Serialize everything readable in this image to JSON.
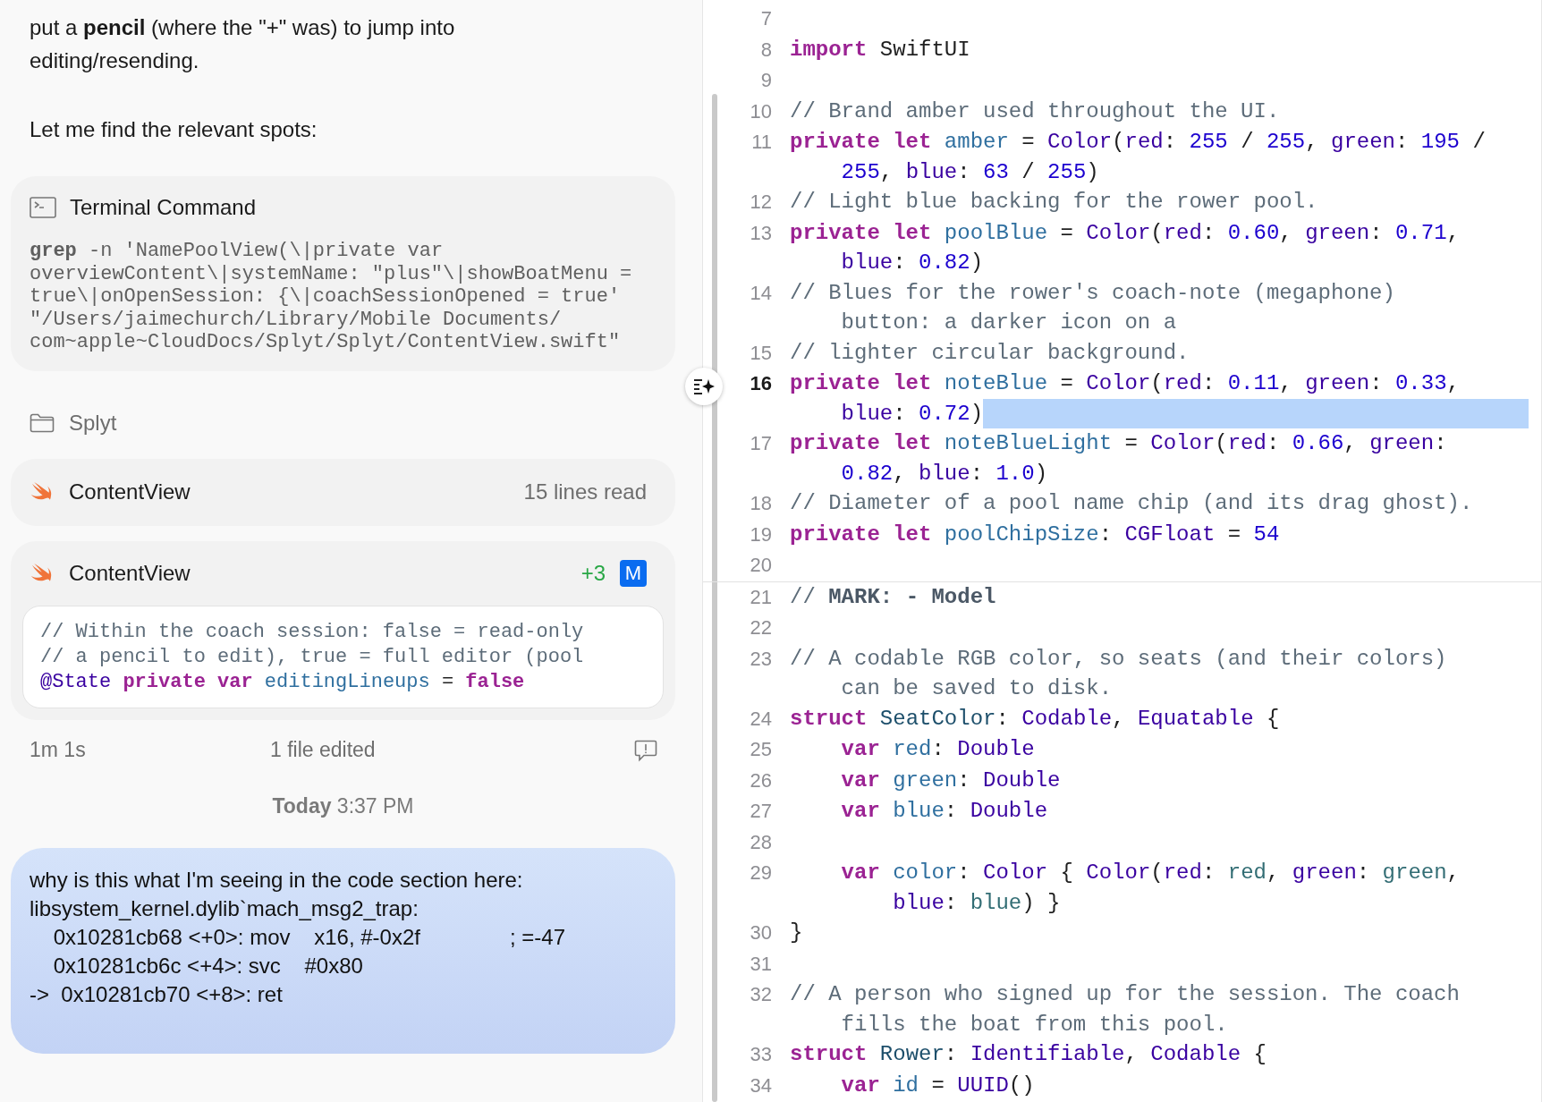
{
  "chat": {
    "paragraph": "put a **pencil** (where the \"+\" was) to jump into editing/resending.",
    "followup": "Let me find the relevant spots:",
    "activity": [
      {
        "kind": "terminal",
        "title": "Terminal Command",
        "command_lines": [
          "**grep** -n 'NamePoolView(\\|private var",
          "overviewContent\\|systemName: \"plus\"\\|showBoatMenu =",
          "true\\|onOpenSession: {\\|coachSessionOpened = true'",
          "\"/Users/jaimechurch/Library/Mobile Documents/",
          "com~apple~CloudDocs/Splyt/Splyt/ContentView.swift\""
        ]
      },
      {
        "kind": "folder",
        "name": "Splyt"
      },
      {
        "kind": "file_read",
        "name": "ContentView",
        "detail": "15 lines read"
      },
      {
        "kind": "file_edit",
        "name": "ContentView",
        "added": "+3",
        "badge": "M",
        "preview": [
          {
            "tokens": [
              {
                "kind": "cmt",
                "text": "// Within the coach session: false = read-only"
              }
            ]
          },
          {
            "tokens": [
              {
                "kind": "cmt",
                "text": "// a pencil to edit), true = full editor (pool"
              }
            ]
          },
          {
            "tokens": [
              {
                "kind": "type",
                "text": "@State "
              },
              {
                "kind": "kw",
                "text": "private var "
              },
              {
                "kind": "decl",
                "text": "editingLineups"
              },
              {
                "kind": "plain",
                "text": " = "
              },
              {
                "kind": "kw",
                "text": "false"
              }
            ]
          }
        ]
      }
    ],
    "footer": {
      "duration": "1m 1s",
      "summary": "1 file edited"
    },
    "timestamp": "**Today** 3:37 PM",
    "user_message": [
      "why is this what I'm seeing in the code section here:",
      "libsystem_kernel.dylib`mach_msg2_trap:",
      "    0x10281cb68 <+0>: mov    x16, #-0x2f               ; =-47",
      "    0x10281cb6c <+4>: svc    #0x80",
      "->  0x10281cb70 <+8>: ret"
    ]
  },
  "editor": {
    "lines": [
      {
        "number": "7",
        "current": false,
        "separator": false
      },
      {
        "number": "8",
        "current": false,
        "separator": false,
        "rows": [
          {
            "tokens": [
              {
                "kind": "kw",
                "text": "import"
              },
              {
                "kind": "plain",
                "text": " SwiftUI"
              }
            ]
          }
        ]
      },
      {
        "number": "9",
        "current": false,
        "separator": false
      },
      {
        "number": "10",
        "current": false,
        "separator": false,
        "rows": [
          {
            "tokens": [
              {
                "kind": "cmt",
                "text": "// Brand amber used throughout the UI."
              }
            ]
          }
        ]
      },
      {
        "number": "11",
        "current": false,
        "separator": false,
        "rows": [
          {
            "tokens": [
              {
                "kind": "kw",
                "text": "private let "
              },
              {
                "kind": "decl",
                "text": "amber"
              },
              {
                "kind": "plain",
                "text": " = "
              },
              {
                "kind": "type",
                "text": "Color"
              },
              {
                "kind": "plain",
                "text": "("
              },
              {
                "kind": "arg",
                "text": "red"
              },
              {
                "kind": "plain",
                "text": ": "
              },
              {
                "kind": "num",
                "text": "255"
              },
              {
                "kind": "plain",
                "text": " / "
              },
              {
                "kind": "num",
                "text": "255"
              },
              {
                "kind": "plain",
                "text": ", "
              },
              {
                "kind": "arg",
                "text": "green"
              },
              {
                "kind": "plain",
                "text": ": "
              },
              {
                "kind": "num",
                "text": "195"
              },
              {
                "kind": "plain",
                "text": " /"
              }
            ]
          },
          {
            "tokens": [
              {
                "kind": "num",
                "text": "255"
              },
              {
                "kind": "plain",
                "text": ", "
              },
              {
                "kind": "arg",
                "text": "blue"
              },
              {
                "kind": "plain",
                "text": ": "
              },
              {
                "kind": "num",
                "text": "63"
              },
              {
                "kind": "plain",
                "text": " / "
              },
              {
                "kind": "num",
                "text": "255"
              },
              {
                "kind": "plain",
                "text": ")"
              }
            ]
          }
        ]
      },
      {
        "number": "12",
        "current": false,
        "separator": false,
        "rows": [
          {
            "tokens": [
              {
                "kind": "cmt",
                "text": "// Light blue backing for the rower pool."
              }
            ]
          }
        ]
      },
      {
        "number": "13",
        "current": false,
        "separator": false,
        "rows": [
          {
            "tokens": [
              {
                "kind": "kw",
                "text": "private let "
              },
              {
                "kind": "decl",
                "text": "poolBlue"
              },
              {
                "kind": "plain",
                "text": " = "
              },
              {
                "kind": "type",
                "text": "Color"
              },
              {
                "kind": "plain",
                "text": "("
              },
              {
                "kind": "arg",
                "text": "red"
              },
              {
                "kind": "plain",
                "text": ": "
              },
              {
                "kind": "num",
                "text": "0.60"
              },
              {
                "kind": "plain",
                "text": ", "
              },
              {
                "kind": "arg",
                "text": "green"
              },
              {
                "kind": "plain",
                "text": ": "
              },
              {
                "kind": "num",
                "text": "0.71"
              },
              {
                "kind": "plain",
                "text": ","
              }
            ]
          },
          {
            "tokens": [
              {
                "kind": "arg",
                "text": "blue"
              },
              {
                "kind": "plain",
                "text": ": "
              },
              {
                "kind": "num",
                "text": "0.82"
              },
              {
                "kind": "plain",
                "text": ")"
              }
            ]
          }
        ]
      },
      {
        "number": "14",
        "current": false,
        "separator": false,
        "rows": [
          {
            "tokens": [
              {
                "kind": "cmt",
                "text": "// Blues for the rower's coach-note (megaphone)"
              }
            ]
          },
          {
            "tokens": [
              {
                "kind": "cmt",
                "text": "button: a darker icon on a"
              }
            ]
          }
        ]
      },
      {
        "number": "15",
        "current": false,
        "separator": false,
        "rows": [
          {
            "tokens": [
              {
                "kind": "cmt",
                "text": "// lighter circular background."
              }
            ]
          }
        ]
      },
      {
        "number": "16",
        "current": true,
        "separator": false,
        "rows": [
          {
            "tokens": [
              {
                "kind": "kw",
                "text": "private let "
              },
              {
                "kind": "decl",
                "text": "noteBlue"
              },
              {
                "kind": "plain",
                "text": " = "
              },
              {
                "kind": "type",
                "text": "Color"
              },
              {
                "kind": "plain",
                "text": "("
              },
              {
                "kind": "arg",
                "text": "red"
              },
              {
                "kind": "plain",
                "text": ": "
              },
              {
                "kind": "num",
                "text": "0.11"
              },
              {
                "kind": "plain",
                "text": ", "
              },
              {
                "kind": "arg",
                "text": "green"
              },
              {
                "kind": "plain",
                "text": ": "
              },
              {
                "kind": "num",
                "text": "0.33"
              },
              {
                "kind": "plain",
                "text": ","
              }
            ]
          },
          {
            "tokens": [
              {
                "kind": "arg",
                "text": "blue"
              },
              {
                "kind": "plain",
                "text": ": "
              },
              {
                "kind": "num",
                "text": "0.72"
              },
              {
                "kind": "plain",
                "text": ")"
              }
            ]
          }
        ]
      },
      {
        "number": "17",
        "current": false,
        "separator": false,
        "rows": [
          {
            "tokens": [
              {
                "kind": "kw",
                "text": "private let "
              },
              {
                "kind": "decl",
                "text": "noteBlueLight"
              },
              {
                "kind": "plain",
                "text": " = "
              },
              {
                "kind": "type",
                "text": "Color"
              },
              {
                "kind": "plain",
                "text": "("
              },
              {
                "kind": "arg",
                "text": "red"
              },
              {
                "kind": "plain",
                "text": ": "
              },
              {
                "kind": "num",
                "text": "0.66"
              },
              {
                "kind": "plain",
                "text": ", "
              },
              {
                "kind": "arg",
                "text": "green"
              },
              {
                "kind": "plain",
                "text": ":"
              }
            ]
          },
          {
            "tokens": [
              {
                "kind": "num",
                "text": "0.82"
              },
              {
                "kind": "plain",
                "text": ", "
              },
              {
                "kind": "arg",
                "text": "blue"
              },
              {
                "kind": "plain",
                "text": ": "
              },
              {
                "kind": "num",
                "text": "1.0"
              },
              {
                "kind": "plain",
                "text": ")"
              }
            ]
          }
        ]
      },
      {
        "number": "18",
        "current": false,
        "separator": false,
        "rows": [
          {
            "tokens": [
              {
                "kind": "cmt",
                "text": "// Diameter of a pool name chip (and its drag ghost)."
              }
            ]
          }
        ]
      },
      {
        "number": "19",
        "current": false,
        "separator": false,
        "rows": [
          {
            "tokens": [
              {
                "kind": "kw",
                "text": "private let "
              },
              {
                "kind": "decl",
                "text": "poolChipSize"
              },
              {
                "kind": "plain",
                "text": ": "
              },
              {
                "kind": "type",
                "text": "CGFloat"
              },
              {
                "kind": "plain",
                "text": " = "
              },
              {
                "kind": "num",
                "text": "54"
              }
            ]
          }
        ]
      },
      {
        "number": "20",
        "current": false,
        "separator": false
      },
      {
        "number": "21",
        "current": false,
        "separator": true,
        "rows": [
          {
            "tokens": [
              {
                "kind": "cmt",
                "text": "// "
              },
              {
                "kind": "mark",
                "text": "MARK: - Model"
              }
            ]
          }
        ]
      },
      {
        "number": "22",
        "current": false,
        "separator": false
      },
      {
        "number": "23",
        "current": false,
        "separator": false,
        "rows": [
          {
            "tokens": [
              {
                "kind": "cmt",
                "text": "// A codable RGB color, so seats (and their colors)"
              }
            ]
          },
          {
            "tokens": [
              {
                "kind": "cmt",
                "text": "can be saved to disk."
              }
            ]
          }
        ]
      },
      {
        "number": "24",
        "current": false,
        "separator": false,
        "rows": [
          {
            "tokens": [
              {
                "kind": "kw",
                "text": "struct "
              },
              {
                "kind": "decl2",
                "text": "SeatColor"
              },
              {
                "kind": "plain",
                "text": ": "
              },
              {
                "kind": "type",
                "text": "Codable"
              },
              {
                "kind": "plain",
                "text": ", "
              },
              {
                "kind": "type",
                "text": "Equatable"
              },
              {
                "kind": "plain",
                "text": " {"
              }
            ]
          }
        ]
      },
      {
        "number": "25",
        "current": false,
        "separator": false,
        "rows": [
          {
            "tokens": [
              {
                "kind": "kw",
                "text": "    var "
              },
              {
                "kind": "decl",
                "text": "red"
              },
              {
                "kind": "plain",
                "text": ": "
              },
              {
                "kind": "type",
                "text": "Double"
              }
            ]
          }
        ]
      },
      {
        "number": "26",
        "current": false,
        "separator": false,
        "rows": [
          {
            "tokens": [
              {
                "kind": "kw",
                "text": "    var "
              },
              {
                "kind": "decl",
                "text": "green"
              },
              {
                "kind": "plain",
                "text": ": "
              },
              {
                "kind": "type",
                "text": "Double"
              }
            ]
          }
        ]
      },
      {
        "number": "27",
        "current": false,
        "separator": false,
        "rows": [
          {
            "tokens": [
              {
                "kind": "kw",
                "text": "    var "
              },
              {
                "kind": "decl",
                "text": "blue"
              },
              {
                "kind": "plain",
                "text": ": "
              },
              {
                "kind": "type",
                "text": "Double"
              }
            ]
          }
        ]
      },
      {
        "number": "28",
        "current": false,
        "separator": false
      },
      {
        "number": "29",
        "current": false,
        "separator": false,
        "rows": [
          {
            "tokens": [
              {
                "kind": "kw",
                "text": "    var "
              },
              {
                "kind": "decl",
                "text": "color"
              },
              {
                "kind": "plain",
                "text": ": "
              },
              {
                "kind": "type",
                "text": "Color"
              },
              {
                "kind": "plain",
                "text": " { "
              },
              {
                "kind": "type",
                "text": "Color"
              },
              {
                "kind": "plain",
                "text": "("
              },
              {
                "kind": "arg",
                "text": "red"
              },
              {
                "kind": "plain",
                "text": ": "
              },
              {
                "kind": "ref",
                "text": "red"
              },
              {
                "kind": "plain",
                "text": ", "
              },
              {
                "kind": "arg",
                "text": "green"
              },
              {
                "kind": "plain",
                "text": ": "
              },
              {
                "kind": "ref",
                "text": "green"
              },
              {
                "kind": "plain",
                "text": ","
              }
            ]
          },
          {
            "tokens": [
              {
                "kind": "arg",
                "text": "    blue"
              },
              {
                "kind": "plain",
                "text": ": "
              },
              {
                "kind": "ref",
                "text": "blue"
              },
              {
                "kind": "plain",
                "text": ") }"
              }
            ]
          }
        ]
      },
      {
        "number": "30",
        "current": false,
        "separator": false,
        "rows": [
          {
            "tokens": [
              {
                "kind": "plain",
                "text": "}"
              }
            ]
          }
        ]
      },
      {
        "number": "31",
        "current": false,
        "separator": false
      },
      {
        "number": "32",
        "current": false,
        "separator": false,
        "rows": [
          {
            "tokens": [
              {
                "kind": "cmt",
                "text": "// A person who signed up for the session. The coach"
              }
            ]
          },
          {
            "tokens": [
              {
                "kind": "cmt",
                "text": "fills the boat from this pool."
              }
            ]
          }
        ]
      },
      {
        "number": "33",
        "current": false,
        "separator": false,
        "rows": [
          {
            "tokens": [
              {
                "kind": "kw",
                "text": "struct "
              },
              {
                "kind": "decl2",
                "text": "Rower"
              },
              {
                "kind": "plain",
                "text": ": "
              },
              {
                "kind": "type",
                "text": "Identifiable"
              },
              {
                "kind": "plain",
                "text": ", "
              },
              {
                "kind": "type",
                "text": "Codable"
              },
              {
                "kind": "plain",
                "text": " {"
              }
            ]
          }
        ]
      },
      {
        "number": "34",
        "current": false,
        "separator": false,
        "rows": [
          {
            "tokens": [
              {
                "kind": "kw",
                "text": "    var "
              },
              {
                "kind": "decl",
                "text": "id"
              },
              {
                "kind": "plain",
                "text": " = "
              },
              {
                "kind": "type",
                "text": "UUID"
              },
              {
                "kind": "plain",
                "text": "()"
              }
            ]
          }
        ]
      }
    ]
  }
}
